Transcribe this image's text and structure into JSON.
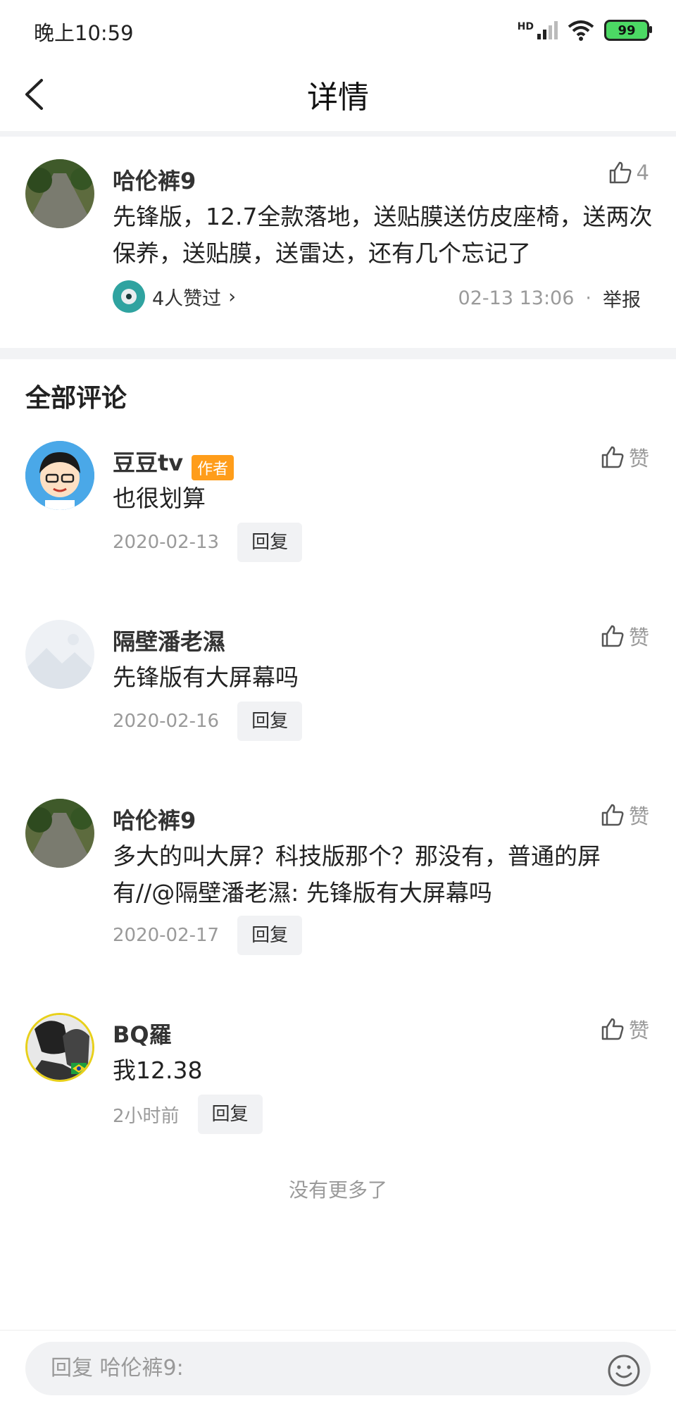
{
  "status_bar": {
    "time": "晚上10:59",
    "network": "HD",
    "battery": "99",
    "battery_color": "#4cd964"
  },
  "nav": {
    "title": "详情",
    "back_icon": "chevron-left-icon"
  },
  "post": {
    "username": "哈伦裤9",
    "like_count": "4",
    "content": "先锋版，12.7全款落地，送贴膜送仿皮座椅，送两次保养，送贴膜，送雷达，还有几个忘记了",
    "liked_by": "4人赞过",
    "liked_by_chevron": "›",
    "timestamp": "02-13 13:06",
    "separator": "·",
    "report": "举报"
  },
  "section_title": "全部评论",
  "comments": [
    {
      "username": "豆豆tv",
      "badge": "作者",
      "content": "也很划算",
      "date": "2020-02-13",
      "reply_label": "回复",
      "like_label": "赞"
    },
    {
      "username": "隔壁潘老濕",
      "content": "先锋版有大屏幕吗",
      "date": "2020-02-16",
      "reply_label": "回复",
      "like_label": "赞"
    },
    {
      "username": "哈伦裤9",
      "content": "多大的叫大屏？科技版那个？那没有，普通的屏有//@隔壁潘老濕: 先锋版有大屏幕吗",
      "date": "2020-02-17",
      "reply_label": "回复",
      "like_label": "赞"
    },
    {
      "username": "BQ羅",
      "content": "我12.38",
      "date": "2小时前",
      "reply_label": "回复",
      "like_label": "赞"
    }
  ],
  "footer_note": "没有更多了",
  "reply_bar": {
    "placeholder": "回复 哈伦裤9:",
    "emoji_icon": "smiley-icon"
  },
  "colors": {
    "author_badge": "#ff9d1a",
    "muted": "#9a9a9a"
  }
}
